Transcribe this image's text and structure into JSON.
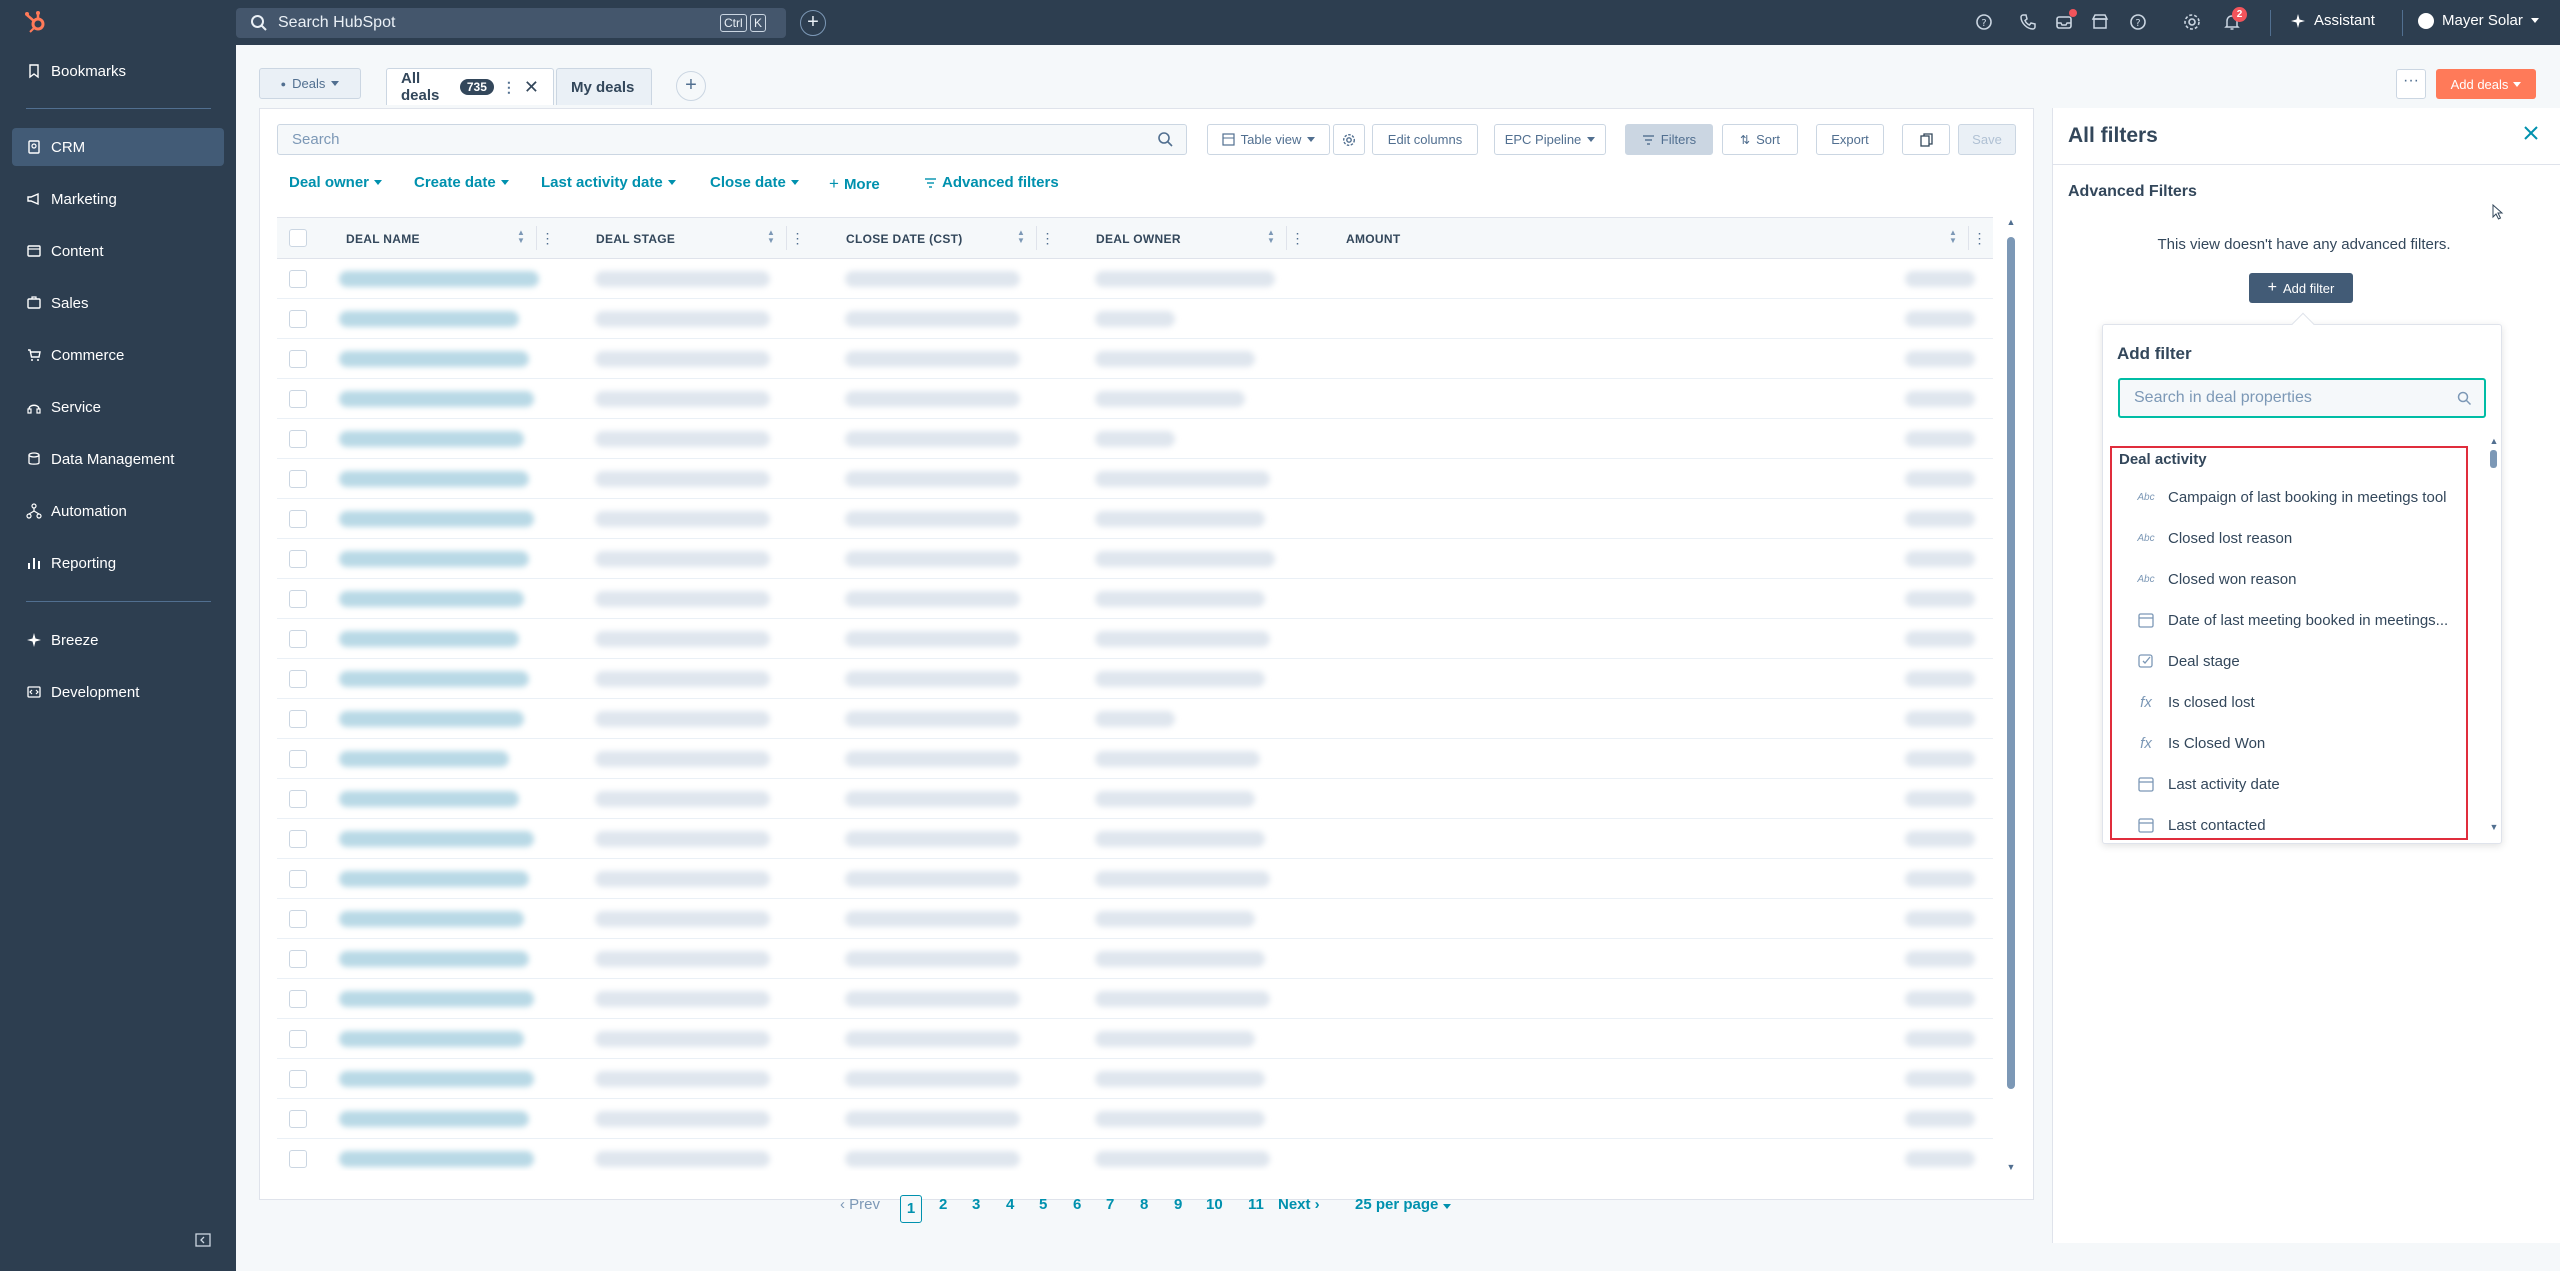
{
  "topbar": {
    "search_placeholder": "Search HubSpot",
    "shortcut_ctrl": "Ctrl",
    "shortcut_k": "K",
    "notifications_count": "2",
    "assistant_label": "Assistant",
    "account_name": "Mayer Solar"
  },
  "sidebar": {
    "items": [
      {
        "label": "Bookmarks",
        "icon": "bookmark-icon"
      },
      {
        "label": "CRM",
        "icon": "crm-icon"
      },
      {
        "label": "Marketing",
        "icon": "megaphone-icon"
      },
      {
        "label": "Content",
        "icon": "content-icon"
      },
      {
        "label": "Sales",
        "icon": "sales-icon"
      },
      {
        "label": "Commerce",
        "icon": "cart-icon"
      },
      {
        "label": "Service",
        "icon": "service-icon"
      },
      {
        "label": "Data Management",
        "icon": "database-icon"
      },
      {
        "label": "Automation",
        "icon": "automation-icon"
      },
      {
        "label": "Reporting",
        "icon": "chart-icon"
      },
      {
        "label": "Breeze",
        "icon": "breeze-icon"
      },
      {
        "label": "Development",
        "icon": "code-icon"
      }
    ]
  },
  "header": {
    "object_selector": "Deals",
    "tabs": [
      {
        "label": "All deals",
        "count": "735"
      },
      {
        "label": "My deals"
      }
    ],
    "add_deals_label": "Add deals",
    "more_label": "···"
  },
  "toolbar": {
    "search_placeholder": "Search",
    "table_view": "Table view",
    "edit_columns": "Edit columns",
    "pipeline": "EPC Pipeline",
    "filters": "Filters",
    "sort": "Sort",
    "export": "Export",
    "save": "Save"
  },
  "quick_filters": {
    "deal_owner": "Deal owner",
    "create_date": "Create date",
    "last_activity_date": "Last activity date",
    "close_date": "Close date",
    "more": "More",
    "advanced_filters": "Advanced filters"
  },
  "table": {
    "columns": [
      "DEAL NAME",
      "DEAL STAGE",
      "CLOSE DATE (CST)",
      "DEAL OWNER",
      "AMOUNT"
    ],
    "row_count_visible": 23
  },
  "pagination": {
    "prev": "Prev",
    "pages": [
      "1",
      "2",
      "3",
      "4",
      "5",
      "6",
      "7",
      "8",
      "9",
      "10",
      "11"
    ],
    "current": "1",
    "next": "Next",
    "per_page": "25 per page"
  },
  "filters_panel": {
    "title": "All filters",
    "subtitle": "Advanced Filters",
    "empty_note": "This view doesn't have any advanced filters.",
    "add_filter_button": "Add filter",
    "popover_title": "Add filter",
    "popover_search_placeholder": "Search in deal properties",
    "group_title": "Deal activity",
    "options": [
      {
        "label": "Campaign of last booking in meetings tool",
        "type": "Abc"
      },
      {
        "label": "Closed lost reason",
        "type": "Abc"
      },
      {
        "label": "Closed won reason",
        "type": "Abc"
      },
      {
        "label": "Date of last meeting booked in meetings...",
        "type": "date"
      },
      {
        "label": "Deal stage",
        "type": "select"
      },
      {
        "label": "Is closed lost",
        "type": "fx"
      },
      {
        "label": "Is Closed Won",
        "type": "fx"
      },
      {
        "label": "Last activity date",
        "type": "date"
      },
      {
        "label": "Last contacted",
        "type": "date"
      }
    ]
  },
  "colors": {
    "nav_bg": "#2d3e50",
    "accent_orange": "#ff7a59",
    "link_teal": "#0091ae",
    "highlight_red": "#e02d3c"
  }
}
